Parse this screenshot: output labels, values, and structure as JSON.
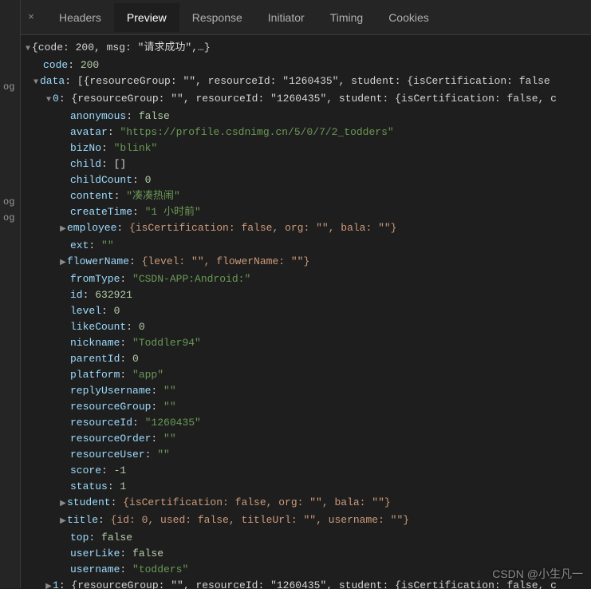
{
  "leftStrip": {
    "line1": "og",
    "line2": "og"
  },
  "tabs": {
    "close": "×",
    "items": [
      {
        "label": "Headers",
        "active": false
      },
      {
        "label": "Preview",
        "active": true
      },
      {
        "label": "Response",
        "active": false
      },
      {
        "label": "Initiator",
        "active": false
      },
      {
        "label": "Timing",
        "active": false
      },
      {
        "label": "Cookies",
        "active": false
      }
    ]
  },
  "summary": {
    "root": "{code: 200, msg: \"请求成功\",…}",
    "code": {
      "key": "code",
      "value": "200"
    },
    "data": {
      "key": "data",
      "preview": "[{resourceGroup: \"\", resourceId: \"1260435\", student: {isCertification: false",
      "item0": {
        "key": "0",
        "preview": "{resourceGroup: \"\", resourceId: \"1260435\", student: {isCertification: false, c"
      },
      "item1": {
        "key": "1",
        "preview": "{resourceGroup: \"\", resourceId: \"1260435\", student: {isCertification: false, c"
      }
    }
  },
  "fields": {
    "anonymous": {
      "key": "anonymous",
      "value": "false",
      "type": "bool"
    },
    "avatar": {
      "key": "avatar",
      "value": "\"https://profile.csdnimg.cn/5/0/7/2_todders\"",
      "type": "str"
    },
    "bizNo": {
      "key": "bizNo",
      "value": "\"blink\"",
      "type": "str"
    },
    "child": {
      "key": "child",
      "value": "[]",
      "type": "punct"
    },
    "childCount": {
      "key": "childCount",
      "value": "0",
      "type": "num"
    },
    "content": {
      "key": "content",
      "value": "\"凑凑热闹\"",
      "type": "str"
    },
    "createTime": {
      "key": "createTime",
      "value": "\"1 小时前\"",
      "type": "str"
    },
    "employee": {
      "key": "employee",
      "value": "{isCertification: false, org: \"\", bala: \"\"}",
      "type": "obj"
    },
    "ext": {
      "key": "ext",
      "value": "\"\"",
      "type": "str"
    },
    "flowerName": {
      "key": "flowerName",
      "value": "{level: \"\", flowerName: \"\"}",
      "type": "obj"
    },
    "fromType": {
      "key": "fromType",
      "value": "\"CSDN-APP:Android:\"",
      "type": "str"
    },
    "id": {
      "key": "id",
      "value": "632921",
      "type": "num"
    },
    "level": {
      "key": "level",
      "value": "0",
      "type": "num"
    },
    "likeCount": {
      "key": "likeCount",
      "value": "0",
      "type": "num"
    },
    "nickname": {
      "key": "nickname",
      "value": "\"Toddler94\"",
      "type": "str"
    },
    "parentId": {
      "key": "parentId",
      "value": "0",
      "type": "num"
    },
    "platform": {
      "key": "platform",
      "value": "\"app\"",
      "type": "str"
    },
    "replyUsername": {
      "key": "replyUsername",
      "value": "\"\"",
      "type": "str"
    },
    "resourceGroup": {
      "key": "resourceGroup",
      "value": "\"\"",
      "type": "str"
    },
    "resourceId": {
      "key": "resourceId",
      "value": "\"1260435\"",
      "type": "str"
    },
    "resourceOrder": {
      "key": "resourceOrder",
      "value": "\"\"",
      "type": "str"
    },
    "resourceUser": {
      "key": "resourceUser",
      "value": "\"\"",
      "type": "str"
    },
    "score": {
      "key": "score",
      "value": "-1",
      "type": "num"
    },
    "status": {
      "key": "status",
      "value": "1",
      "type": "num"
    },
    "student": {
      "key": "student",
      "value": "{isCertification: false, org: \"\", bala: \"\"}",
      "type": "obj"
    },
    "title": {
      "key": "title",
      "value": "{id: 0, used: false, titleUrl: \"\", username: \"\"}",
      "type": "obj"
    },
    "top": {
      "key": "top",
      "value": "false",
      "type": "bool"
    },
    "userLike": {
      "key": "userLike",
      "value": "false",
      "type": "bool"
    },
    "username": {
      "key": "username",
      "value": "\"todders\"",
      "type": "str"
    }
  },
  "watermark": "CSDN @小生凡一"
}
